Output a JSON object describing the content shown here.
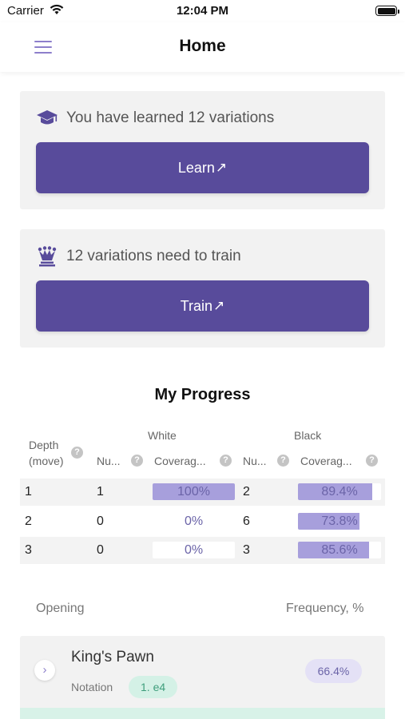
{
  "status_bar": {
    "carrier": "Carrier",
    "time": "12:04 PM"
  },
  "nav": {
    "title": "Home"
  },
  "learn_card": {
    "text": "You have learned 12 variations",
    "button_label": "Learn",
    "button_arrow": "↗"
  },
  "train_card": {
    "text": "12 variations need to train",
    "button_label": "Train",
    "button_arrow": "↗"
  },
  "progress": {
    "title": "My Progress",
    "group_white": "White",
    "group_black": "Black",
    "col_depth": "Depth",
    "col_depth_sub": "(move)",
    "col_num": "Nu...",
    "col_coverage": "Coverag...",
    "help_glyph": "?",
    "rows": [
      {
        "depth": "1",
        "white_num": "1",
        "white_cov": "100%",
        "white_cov_value": 100,
        "black_num": "2",
        "black_cov": "89.4%",
        "black_cov_value": 89.4
      },
      {
        "depth": "2",
        "white_num": "0",
        "white_cov": "0%",
        "white_cov_value": 0,
        "black_num": "6",
        "black_cov": "73.8%",
        "black_cov_value": 73.8
      },
      {
        "depth": "3",
        "white_num": "0",
        "white_cov": "0%",
        "white_cov_value": 0,
        "black_num": "3",
        "black_cov": "85.6%",
        "black_cov_value": 85.6
      }
    ]
  },
  "openings": {
    "col_opening": "Opening",
    "col_frequency": "Frequency, %",
    "items": [
      {
        "name": "King's Pawn",
        "notation_label": "Notation",
        "notation": "1. e4",
        "frequency": "66.4%"
      }
    ]
  },
  "colors": {
    "accent": "#584b9b",
    "bar_fill": "#a79fdc",
    "notation_bg": "#d4f1e6"
  },
  "icons": {
    "learn": "graduation-cap-icon",
    "train": "chess-queen-icon",
    "menu": "hamburger-menu-icon",
    "expand": "chevron-right-icon"
  }
}
